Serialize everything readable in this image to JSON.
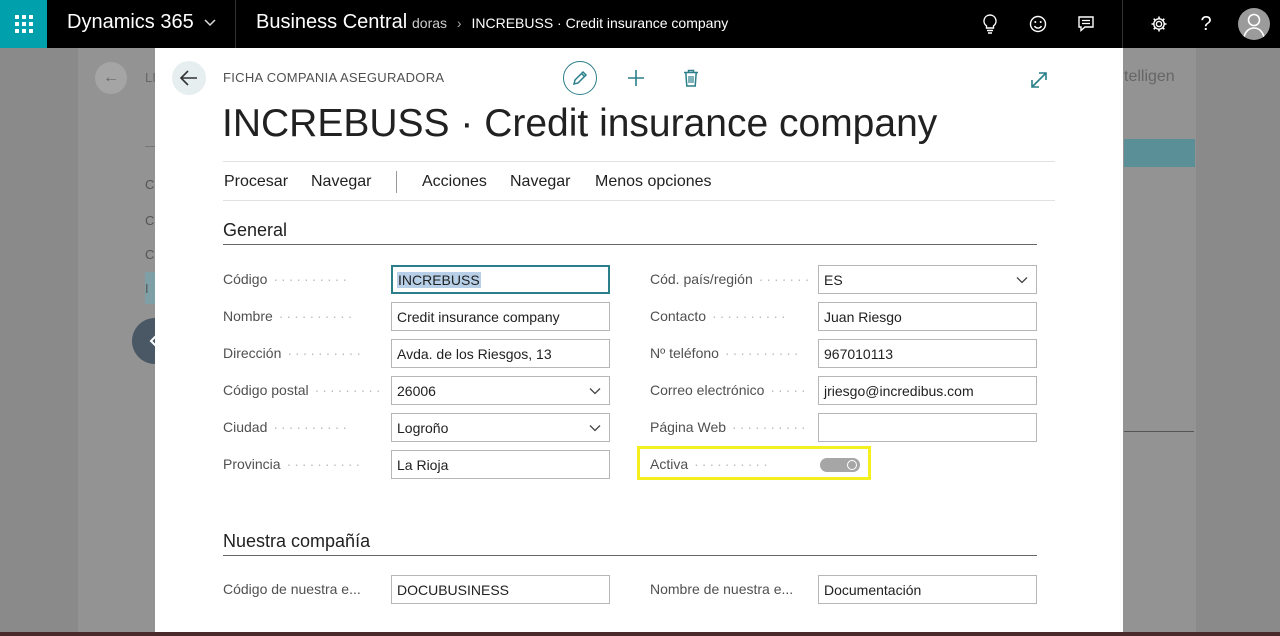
{
  "topbar": {
    "brand": "Dynamics 365",
    "app": "Business Central",
    "breadcrumb_prev": "doras",
    "breadcrumb_current": "INCREBUSS · Credit insurance company",
    "icons": [
      "lightbulb-icon",
      "smiley-icon",
      "chat-icon",
      "gear-icon",
      "help-icon",
      "avatar-icon"
    ]
  },
  "background": {
    "back_label": "←",
    "list_label": "LI",
    "intelligence_label": "telligen",
    "side_letters": [
      "C",
      "C",
      "C",
      "I"
    ]
  },
  "modal": {
    "page_type": "FICHA COMPANIA ASEGURADORA",
    "title": "INCREBUSS · Credit insurance company",
    "actions": [
      "Procesar",
      "Navegar",
      "Acciones",
      "Navegar",
      "Menos opciones"
    ],
    "sections": {
      "general": {
        "title": "General",
        "left": [
          {
            "label": "Código",
            "value": "INCREBUSS"
          },
          {
            "label": "Nombre",
            "value": "Credit insurance company"
          },
          {
            "label": "Dirección",
            "value": "Avda. de los Riesgos, 13"
          },
          {
            "label": "Código postal",
            "value": "26006"
          },
          {
            "label": "Ciudad",
            "value": "Logroño"
          },
          {
            "label": "Provincia",
            "value": "La Rioja"
          }
        ],
        "right": [
          {
            "label": "Cód. país/región",
            "value": "ES"
          },
          {
            "label": "Contacto",
            "value": "Juan Riesgo"
          },
          {
            "label": "Nº teléfono",
            "value": "967010113"
          },
          {
            "label": "Correo electrónico",
            "value": "jriesgo@incredibus.com"
          },
          {
            "label": "Página Web",
            "value": ""
          },
          {
            "label": "Activa",
            "value": false
          }
        ]
      },
      "company": {
        "title": "Nuestra compañía",
        "left": {
          "label": "Código de nuestra e...",
          "value": "DOCUBUSINESS"
        },
        "right": {
          "label": "Nombre de nuestra e...",
          "value": "Documentación"
        }
      }
    }
  },
  "colors": {
    "accent": "#2a7f8a",
    "highlight": "#f4f01e",
    "waffle": "#00a1ad"
  }
}
